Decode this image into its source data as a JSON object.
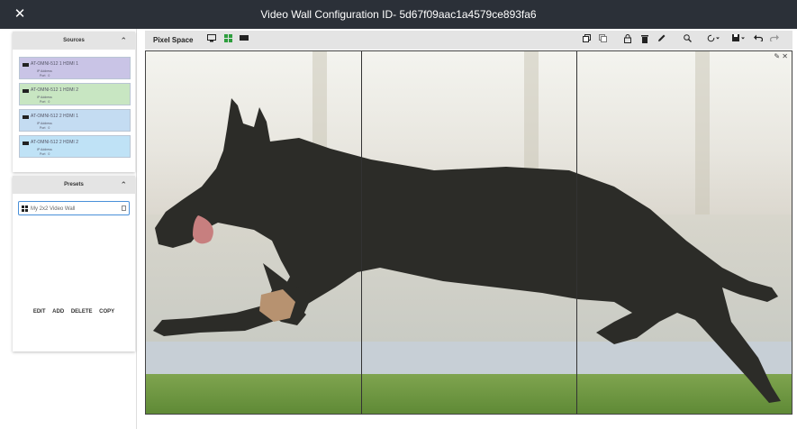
{
  "window": {
    "title": "Video Wall Configuration ID- 5d67f09aac1a4579ce893fa6",
    "close_glyph": "✕"
  },
  "sources": {
    "title": "Sources",
    "collapse_glyph": "⌃",
    "items": [
      {
        "name": "AT-OMNI-512 1 HDMI 1",
        "ip_label": "IP Address",
        "port_label": "Port",
        "port_value": "0",
        "color": "#c9c4e6"
      },
      {
        "name": "AT-OMNI-512 1 HDMI 2",
        "ip_label": "IP Address",
        "port_label": "Port",
        "port_value": "0",
        "color": "#c8e6c2"
      },
      {
        "name": "AT-OMNI-512 2 HDMI 1",
        "ip_label": "IP Address",
        "port_label": "Port",
        "port_value": "0",
        "color": "#c4dcf2"
      },
      {
        "name": "AT-OMNI-512 2 HDMI 2",
        "ip_label": "IP Address",
        "port_label": "Port",
        "port_value": "0",
        "color": "#bfe2f6"
      }
    ]
  },
  "presets": {
    "title": "Presets",
    "collapse_glyph": "⌃",
    "items": [
      {
        "name": "My 2x2 Video Wall"
      }
    ],
    "actions": {
      "edit": "EDIT",
      "add": "ADD",
      "delete": "DELETE",
      "copy": "COPY"
    }
  },
  "toolbar": {
    "title": "Pixel Space",
    "icons": {
      "monitor": "monitor-icon",
      "grid": "grid-icon",
      "display": "display-icon",
      "copy": "copy-icon",
      "paste": "paste-icon",
      "lock": "lock-icon",
      "delete": "trash-icon",
      "edit": "pencil-icon",
      "zoom": "zoom-icon",
      "refresh": "refresh-icon",
      "save": "save-icon",
      "undo": "undo-icon",
      "redo": "redo-icon"
    },
    "colors": {
      "active": "#2e9e3e"
    }
  },
  "canvas": {
    "corner_glyph": "✎ ✕"
  }
}
